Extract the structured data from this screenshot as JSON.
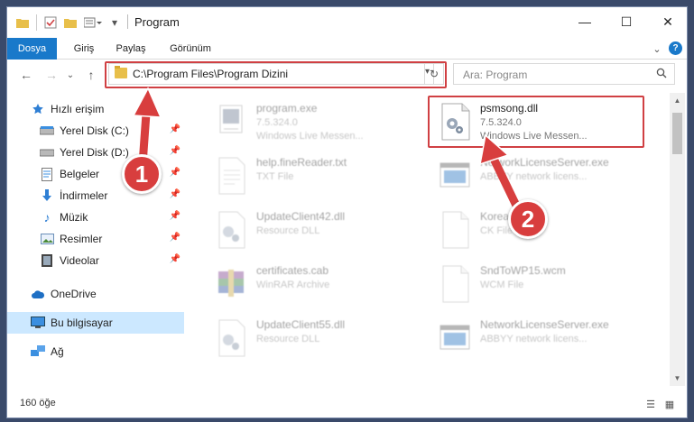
{
  "window": {
    "title": "Program",
    "minimize": "—",
    "maximize": "☐",
    "close": "✕"
  },
  "ribbon": {
    "tabs": [
      "Dosya",
      "Giriş",
      "Paylaş",
      "Görünüm"
    ],
    "help": "?"
  },
  "address": {
    "path": "C:\\Program Files\\Program Dizini",
    "search_placeholder": "Ara: Program"
  },
  "sidebar": {
    "items": [
      {
        "label": "Hızlı erişim",
        "icon": "star-icon",
        "pinned": false
      },
      {
        "label": "Yerel Disk (C:)",
        "icon": "drive-icon",
        "pinned": true
      },
      {
        "label": "Yerel Disk (D:)",
        "icon": "drive-icon",
        "pinned": true
      },
      {
        "label": "Belgeler",
        "icon": "document-icon",
        "pinned": true
      },
      {
        "label": "İndirmeler",
        "icon": "download-icon",
        "pinned": true
      },
      {
        "label": "Müzik",
        "icon": "music-icon",
        "pinned": true
      },
      {
        "label": "Resimler",
        "icon": "picture-icon",
        "pinned": true
      },
      {
        "label": "Videolar",
        "icon": "video-icon",
        "pinned": true
      },
      {
        "label": "OneDrive",
        "icon": "cloud-icon",
        "pinned": false
      },
      {
        "label": "Bu bilgisayar",
        "icon": "computer-icon",
        "pinned": false,
        "active": true
      },
      {
        "label": "Ağ",
        "icon": "network-icon",
        "pinned": false
      }
    ]
  },
  "files": [
    {
      "name": "program.exe",
      "line1": "7.5.324.0",
      "line2": "Windows Live Messen...",
      "icon": "exe-icon",
      "highlighted": false
    },
    {
      "name": "psmsong.dll",
      "line1": "7.5.324.0",
      "line2": "Windows Live Messen...",
      "icon": "dll-gear-icon",
      "highlighted": true
    },
    {
      "name": "help.fineReader.txt",
      "line1": "TXT File",
      "line2": "",
      "icon": "text-file-icon",
      "highlighted": false
    },
    {
      "name": "NetworkLicenseServer.exe",
      "line1": "ABBYY network licens...",
      "line2": "",
      "icon": "exe-window-icon",
      "highlighted": false
    },
    {
      "name": "UpdateClient42.dll",
      "line1": "Resource DLL",
      "line2": "",
      "icon": "dll-gear-icon",
      "highlighted": false
    },
    {
      "name": "Korean.ck",
      "line1": "CK File",
      "line2": "",
      "icon": "blank-file-icon",
      "highlighted": false
    },
    {
      "name": "certificates.cab",
      "line1": "WinRAR Archive",
      "line2": "",
      "icon": "archive-icon",
      "highlighted": false
    },
    {
      "name": "SndToWP15.wcm",
      "line1": "WCM File",
      "line2": "",
      "icon": "blank-file-icon",
      "highlighted": false
    },
    {
      "name": "UpdateClient55.dll",
      "line1": "Resource DLL",
      "line2": "",
      "icon": "dll-gear-icon",
      "highlighted": false
    },
    {
      "name": "NetworkLicenseServer.exe",
      "line1": "ABBYY network licens...",
      "line2": "",
      "icon": "exe-window-icon",
      "highlighted": false
    }
  ],
  "status": {
    "count": "160 öğe"
  },
  "callouts": [
    "1",
    "2"
  ],
  "colors": {
    "accent": "#1979ca",
    "highlight_red": "#d04043",
    "badge_red": "#d83e3e",
    "selected_row": "#cce8ff"
  }
}
